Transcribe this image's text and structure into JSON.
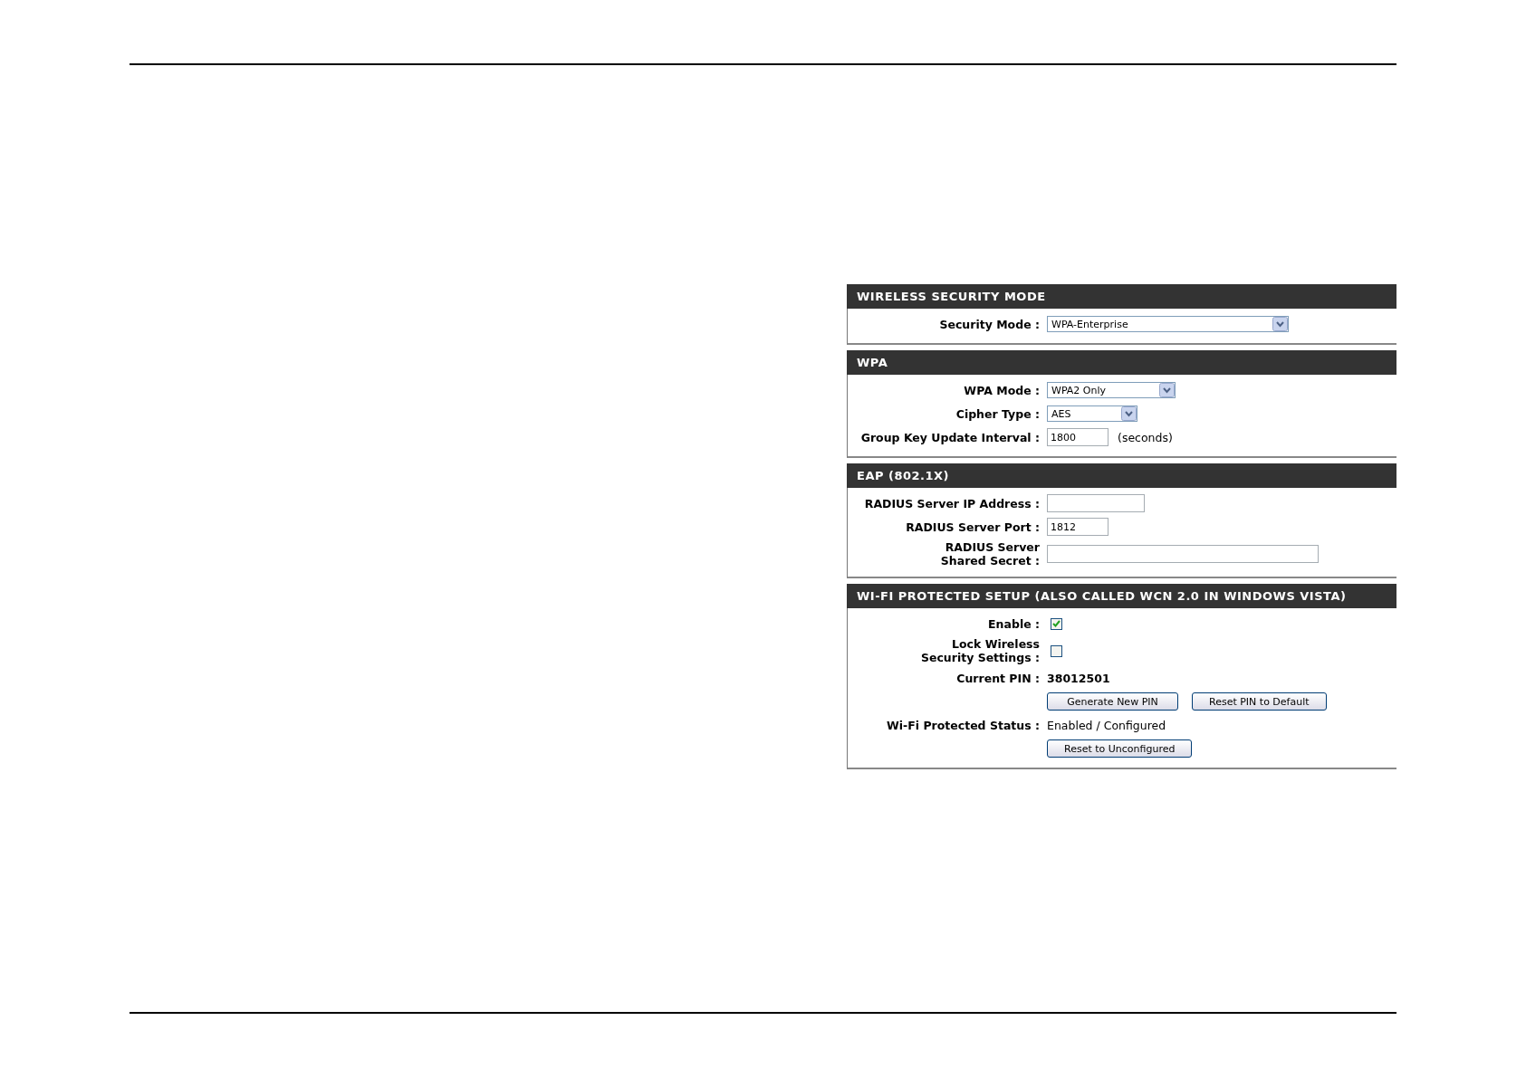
{
  "sections": [
    {
      "title": "WIRELESS SECURITY MODE",
      "rows": [
        {
          "kind": "select",
          "label": "Security Mode :",
          "value": "WPA-Enterprise"
        }
      ]
    },
    {
      "title": "WPA",
      "rows": [
        {
          "kind": "select",
          "label": "WPA Mode :",
          "value": "WPA2 Only"
        },
        {
          "kind": "select",
          "label": "Cipher Type :",
          "value": "AES"
        },
        {
          "kind": "text",
          "label": "Group Key Update Interval :",
          "value": "1800",
          "suffix": "(seconds)"
        }
      ]
    },
    {
      "title": "EAP (802.1X)",
      "rows": [
        {
          "kind": "text",
          "label": "RADIUS Server IP Address :",
          "value": ""
        },
        {
          "kind": "text",
          "label": "RADIUS Server Port :",
          "value": "1812"
        },
        {
          "kind": "text",
          "label": "RADIUS Server Shared Secret :",
          "value": ""
        }
      ]
    },
    {
      "title": "WI-FI PROTECTED SETUP (ALSO CALLED WCN 2.0 IN WINDOWS VISTA)",
      "rows": [
        {
          "kind": "checkbox",
          "label": "Enable :",
          "checked": true
        },
        {
          "kind": "checkbox",
          "label": "Lock Wireless Security Settings :",
          "checked": false
        },
        {
          "kind": "pin",
          "label": "Current PIN :",
          "value": "38012501"
        },
        {
          "kind": "buttons",
          "buttons": [
            "Generate New PIN",
            "Reset PIN to Default"
          ]
        },
        {
          "kind": "status",
          "label": "Wi-Fi Protected Status :",
          "value": "Enabled / Configured"
        },
        {
          "kind": "buttons",
          "buttons": [
            "Reset to Unconfigured"
          ]
        }
      ]
    }
  ]
}
